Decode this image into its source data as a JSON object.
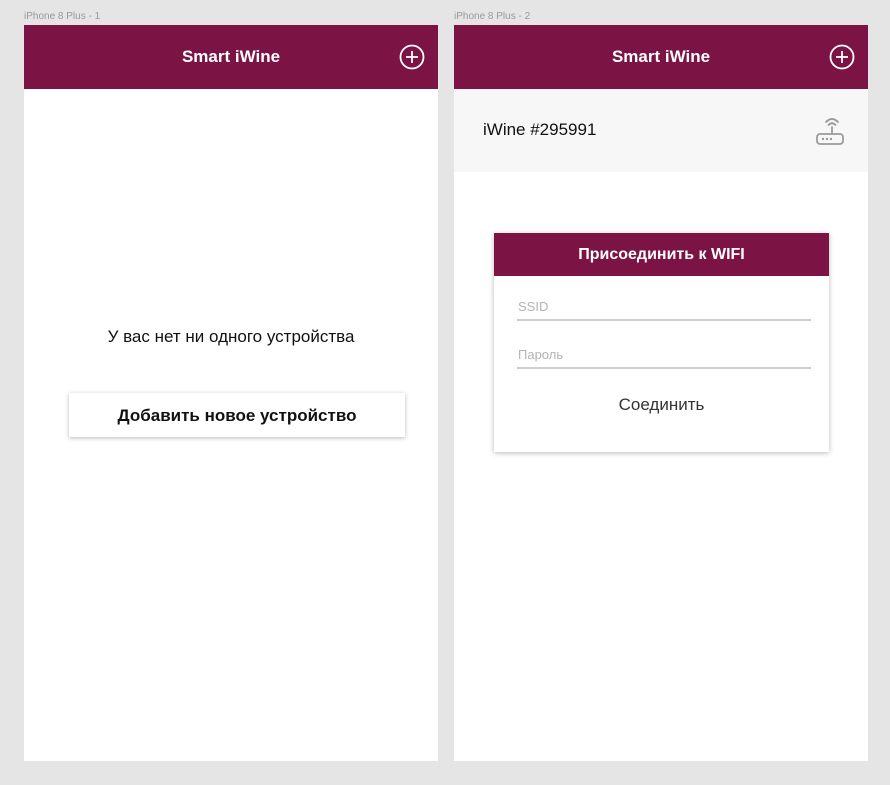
{
  "artboards": [
    {
      "label": "iPhone 8 Plus - 1"
    },
    {
      "label": "iPhone 8 Plus - 2"
    }
  ],
  "app": {
    "title": "Smart iWine",
    "add_icon": "plus-circle-icon",
    "accent_color": "#7b1445"
  },
  "screen1": {
    "empty_message": "У вас нет ни одного устройства",
    "add_device_label": "Добавить новое устройство"
  },
  "screen2": {
    "device": {
      "name": "iWine #295991",
      "icon": "router-icon"
    },
    "wifi_dialog": {
      "title": "Присоединить к WIFI",
      "ssid_placeholder": "SSID",
      "password_placeholder": "Пароль",
      "connect_label": "Соединить"
    }
  }
}
